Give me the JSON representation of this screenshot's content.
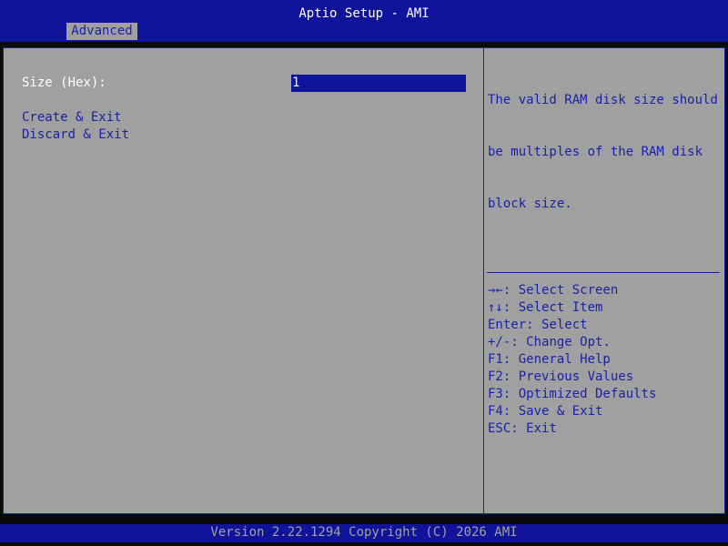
{
  "header": {
    "title": "Aptio Setup - AMI",
    "active_tab": "Advanced"
  },
  "main": {
    "size_label": "Size (Hex):",
    "size_value": "1",
    "menu_items": [
      {
        "label": "Create & Exit"
      },
      {
        "label": "Discard & Exit"
      }
    ]
  },
  "help": {
    "description_lines": [
      "The valid RAM disk size should",
      "be multiples of the RAM disk",
      "block size."
    ],
    "keys": [
      {
        "key": "→←",
        "action": ": Select Screen"
      },
      {
        "key": "↑↓",
        "action": ": Select Item"
      },
      {
        "key": "Enter",
        "action": ": Select"
      },
      {
        "key": "+/-",
        "action": ": Change Opt."
      },
      {
        "key": "F1",
        "action": ": General Help"
      },
      {
        "key": "F2",
        "action": ": Previous Values"
      },
      {
        "key": "F3",
        "action": ": Optimized Defaults"
      },
      {
        "key": "F4",
        "action": ": Save & Exit"
      },
      {
        "key": "ESC",
        "action": ": Exit"
      }
    ]
  },
  "footer": {
    "version_text": "Version 2.22.1294 Copyright (C) 2026 AMI"
  },
  "colors": {
    "header_blue": "#10149a",
    "panel_gray": "#a0a0a0",
    "text_blue": "#1a22a8",
    "text_white": "#ffffff"
  }
}
